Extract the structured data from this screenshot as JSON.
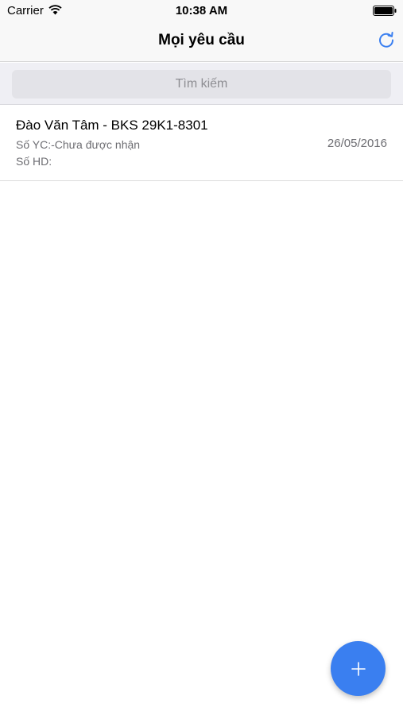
{
  "status_bar": {
    "carrier": "Carrier",
    "time": "10:38 AM"
  },
  "nav": {
    "title": "Mọi yêu cầu",
    "refresh_icon": "refresh-icon"
  },
  "search": {
    "placeholder": "Tìm kiếm",
    "value": ""
  },
  "requests": [
    {
      "title": "Đào Văn Tâm - BKS 29K1-8301",
      "request_no": "Số YC:-Chưa được nhận",
      "contract_no": "Số HD:",
      "date": "26/05/2016"
    }
  ],
  "fab": {
    "icon": "plus-icon"
  },
  "colors": {
    "accent": "#3a7ff0",
    "bar_bg": "#f8f8f8",
    "search_bg": "#efeff4"
  }
}
